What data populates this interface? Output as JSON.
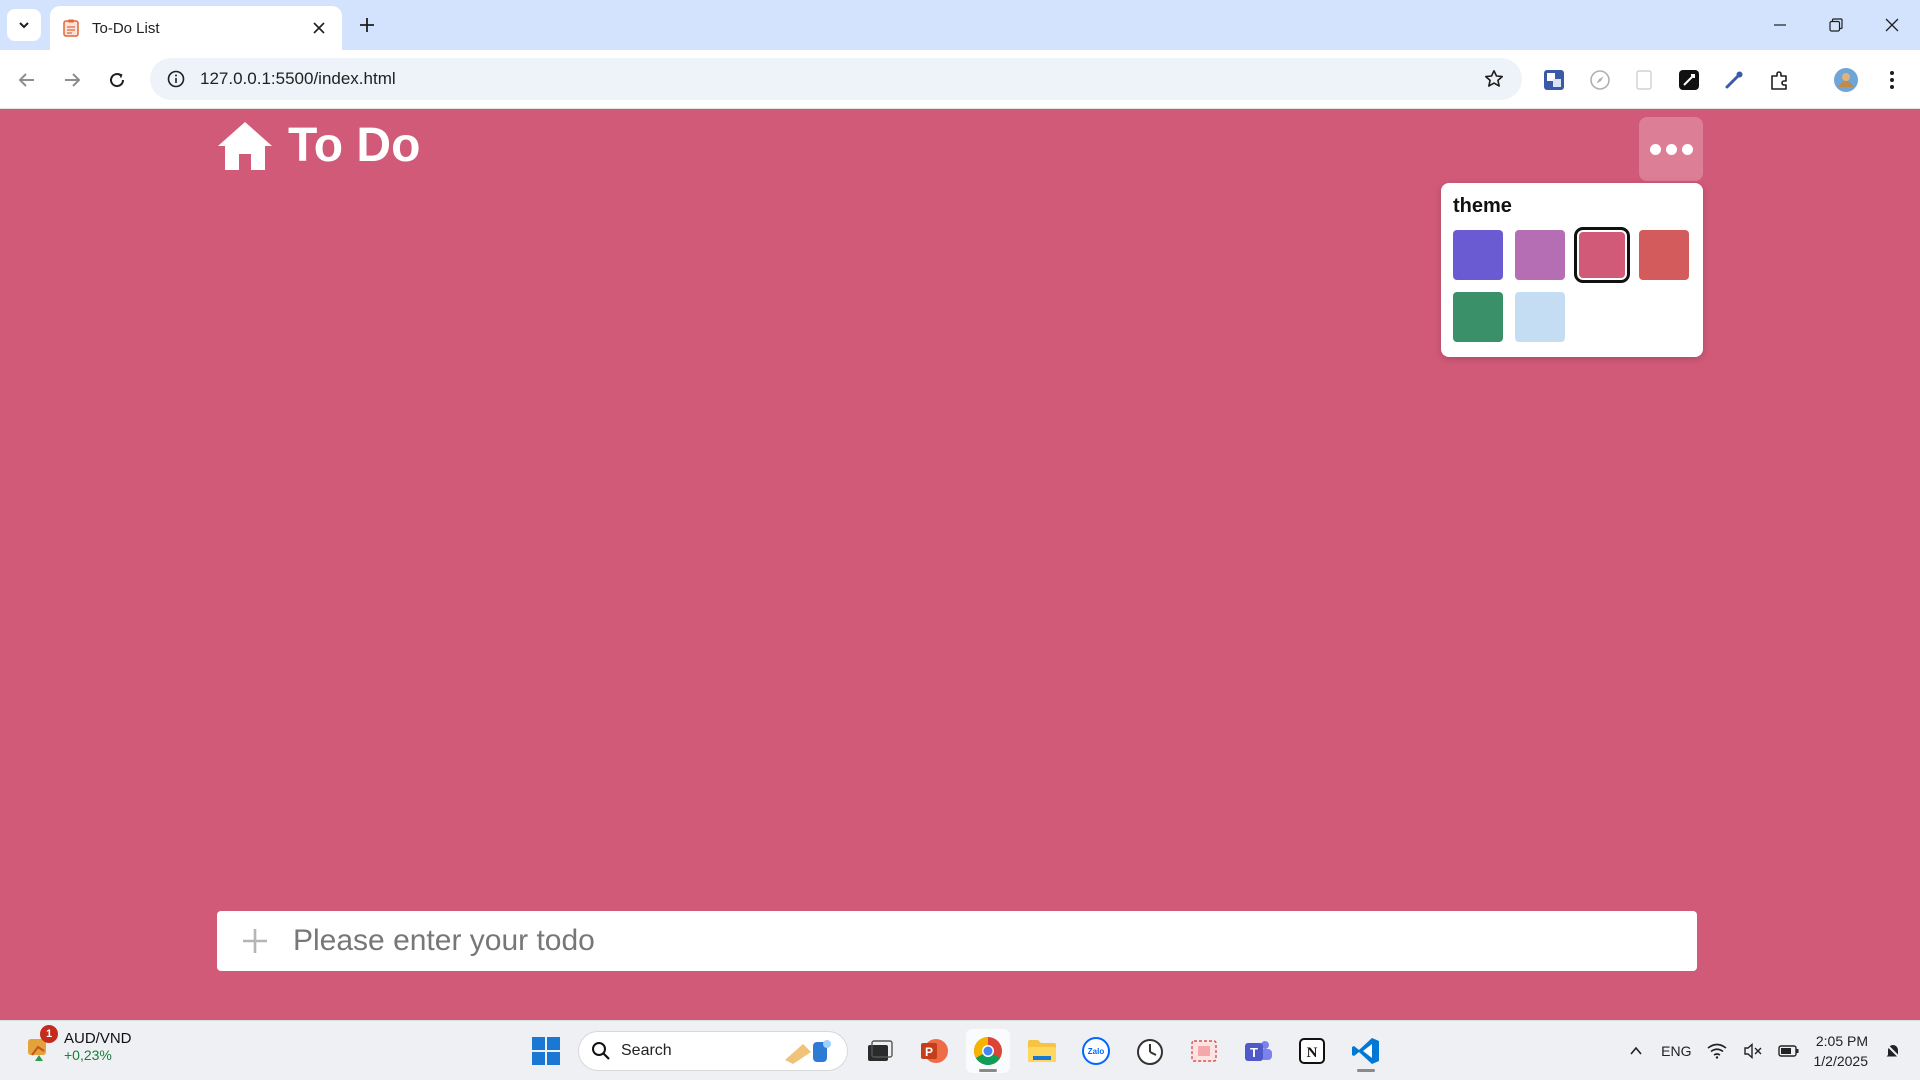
{
  "browser": {
    "tab_title": "To-Do List",
    "url": "127.0.0.1:5500/index.html"
  },
  "app": {
    "title": "To Do",
    "theme_label": "theme",
    "themes": [
      {
        "color": "#6b5bd2",
        "selected": false
      },
      {
        "color": "#b56db4",
        "selected": false
      },
      {
        "color": "#d15a79",
        "selected": true
      },
      {
        "color": "#d45b5b",
        "selected": false
      },
      {
        "color": "#3a9068",
        "selected": false
      },
      {
        "color": "#c5ddf2",
        "selected": false
      }
    ],
    "todo_placeholder": "Please enter your todo",
    "background_color": "#d15a79"
  },
  "taskbar": {
    "ticker_badge": "1",
    "ticker_name": "AUD/VND",
    "ticker_change": "+0,23%",
    "search_label": "Search",
    "lang": "ENG",
    "time": "2:05 PM",
    "date": "1/2/2025",
    "apps": [
      "windows-start",
      "search",
      "file-explorer-dark",
      "powerpoint",
      "chrome",
      "file-explorer",
      "zalo",
      "clock",
      "snipping",
      "teams",
      "notion",
      "vscode"
    ]
  }
}
